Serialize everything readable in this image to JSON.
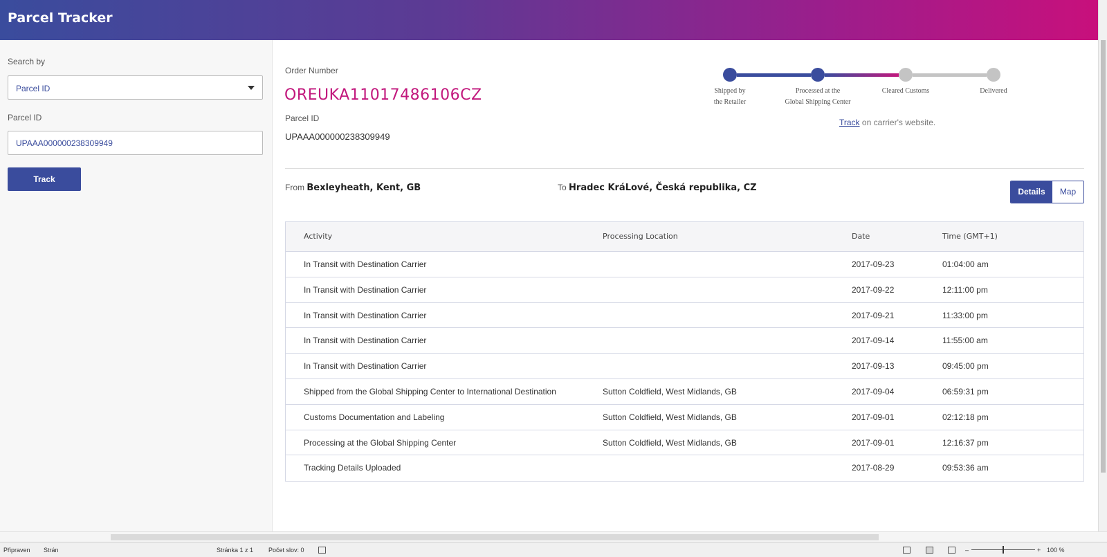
{
  "header": {
    "title": "Parcel Tracker"
  },
  "sidebar": {
    "search_by_label": "Search by",
    "search_by_value": "Parcel ID",
    "parcel_id_label": "Parcel ID",
    "parcel_id_value": "UPAAA000000238309949",
    "track_button": "Track"
  },
  "order": {
    "order_label": "Order Number",
    "order_number": "OREUKA11017486106CZ",
    "parcel_label": "Parcel ID",
    "parcel_id": "UPAAA000000238309949"
  },
  "progress": {
    "steps": [
      {
        "line1": "Shipped by",
        "line2": "the Retailer",
        "done": true
      },
      {
        "line1": "Processed at the",
        "line2": "Global Shipping Center",
        "done": true
      },
      {
        "line1": "Cleared Customs",
        "line2": "",
        "done": false
      },
      {
        "line1": "Delivered",
        "line2": "",
        "done": false
      }
    ],
    "track_link": "Track",
    "track_suffix": " on carrier's website.",
    "colors": {
      "done": "#3a4c9d",
      "pending": "#c4c4c4",
      "accent": "#c2187d"
    }
  },
  "route": {
    "from_prefix": "From",
    "from_place": "Bexleyheath, Kent, GB",
    "to_prefix": "To",
    "to_place": "Hradec KráLové, Česká republika, CZ"
  },
  "view_toggle": {
    "details": "Details",
    "map": "Map",
    "selected": "Details"
  },
  "table": {
    "headers": [
      "Activity",
      "Processing Location",
      "Date",
      "Time (GMT+1)"
    ],
    "rows": [
      [
        "In Transit with Destination Carrier",
        "",
        "2017-09-23",
        "01:04:00 am"
      ],
      [
        "In Transit with Destination Carrier",
        "",
        "2017-09-22",
        "12:11:00 pm"
      ],
      [
        "In Transit with Destination Carrier",
        "",
        "2017-09-21",
        "11:33:00 pm"
      ],
      [
        "In Transit with Destination Carrier",
        "",
        "2017-09-14",
        "11:55:00 am"
      ],
      [
        "In Transit with Destination Carrier",
        "",
        "2017-09-13",
        "09:45:00 pm"
      ],
      [
        "Shipped from the Global Shipping Center to International Destination",
        "Sutton Coldfield, West Midlands, GB",
        "2017-09-04",
        "06:59:31 pm"
      ],
      [
        "Customs Documentation and Labeling",
        "Sutton Coldfield, West Midlands, GB",
        "2017-09-01",
        "02:12:18 pm"
      ],
      [
        "Processing at the Global Shipping Center",
        "Sutton Coldfield, West Midlands, GB",
        "2017-09-01",
        "12:16:37 pm"
      ],
      [
        "Tracking Details Uploaded",
        "",
        "2017-08-29",
        "09:53:36 am"
      ]
    ]
  },
  "statusbar": {
    "ready": "Připraven",
    "page_trunc": "Strán",
    "page": "Stránka 1 z 1",
    "words": "Počet slov: 0",
    "zoom_minus": "–",
    "zoom_plus": "+",
    "zoom": "100 %"
  }
}
